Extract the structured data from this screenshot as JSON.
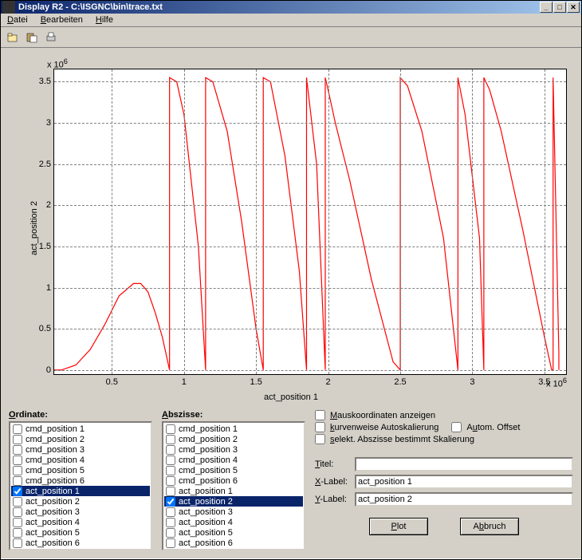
{
  "window": {
    "title": "Display R2 - C:\\ISGNC\\bin\\trace.txt"
  },
  "menu": {
    "file": "Datei",
    "edit": "Bearbeiten",
    "help": "Hilfe"
  },
  "toolbar": {
    "open": "open-file",
    "paste": "paste",
    "print": "print"
  },
  "chart_data": {
    "type": "line",
    "title": "",
    "xlabel": "act_position 1",
    "ylabel": "act_position 2",
    "x_exponent": "x 10",
    "x_exponent_sup": "6",
    "y_exponent": "x 10",
    "y_exponent_sup": "6",
    "xlim": [
      0.1,
      3.65
    ],
    "ylim": [
      -0.05,
      3.65
    ],
    "xticks": [
      0.5,
      1,
      1.5,
      2,
      2.5,
      3,
      3.5
    ],
    "yticks": [
      0,
      0.5,
      1,
      1.5,
      2,
      2.5,
      3,
      3.5
    ],
    "series": [
      {
        "name": "act_position",
        "color": "#ff0000",
        "x": [
          0.1,
          0.15,
          0.25,
          0.35,
          0.45,
          0.55,
          0.65,
          0.7,
          0.75,
          0.8,
          0.85,
          0.9,
          0.9,
          0.95,
          1.0,
          1.1,
          1.15,
          1.15,
          1.2,
          1.3,
          1.4,
          1.5,
          1.55,
          1.55,
          1.6,
          1.7,
          1.8,
          1.85,
          1.85,
          1.92,
          1.98,
          1.98,
          2.0,
          2.05,
          2.15,
          2.3,
          2.45,
          2.5,
          2.5,
          2.55,
          2.65,
          2.8,
          2.9,
          2.9,
          2.95,
          3.05,
          3.08,
          3.08,
          3.12,
          3.2,
          3.35,
          3.5,
          3.55,
          3.56,
          3.56,
          3.6,
          3.6
        ],
        "y": [
          0.0,
          0.0,
          0.06,
          0.25,
          0.55,
          0.9,
          1.05,
          1.05,
          0.95,
          0.7,
          0.4,
          0.0,
          3.55,
          3.5,
          3.1,
          1.5,
          0.0,
          3.55,
          3.5,
          2.9,
          1.8,
          0.5,
          0.0,
          3.55,
          3.5,
          2.6,
          1.2,
          0.0,
          3.55,
          2.5,
          0.0,
          3.55,
          3.4,
          3.0,
          2.3,
          1.1,
          0.1,
          0.0,
          3.55,
          3.45,
          2.9,
          1.6,
          0.0,
          3.55,
          3.1,
          1.6,
          0.0,
          3.55,
          3.4,
          2.9,
          1.7,
          0.4,
          0.0,
          0.0,
          3.55,
          0.2,
          0.0
        ]
      }
    ]
  },
  "panel": {
    "ordinate_label": "Ordinate:",
    "abszisse_label": "Abszisse:",
    "list_items": [
      "cmd_position 1",
      "cmd_position 2",
      "cmd_position 3",
      "cmd_position 4",
      "cmd_position 5",
      "cmd_position 6",
      "act_position 1",
      "act_position 2",
      "act_position 3",
      "act_position 4",
      "act_position 5",
      "act_position 6"
    ],
    "ordinate_selected_index": 6,
    "abszisse_selected_index": 7,
    "check_maus": "Mauskoordinaten anzeigen",
    "check_kurv": "kurvenweise Autoskalierung",
    "check_autooff": "Autom. Offset",
    "check_selekt": "selekt. Abszisse bestimmt Skalierung",
    "titel_label": "Titel:",
    "xlabel_label": "X-Label:",
    "ylabel_label": "Y-Label:",
    "titel_value": "",
    "xlabel_value": "act_position 1",
    "ylabel_value": "act_position 2",
    "plot_btn": "Plot",
    "cancel_btn": "Abbruch"
  }
}
